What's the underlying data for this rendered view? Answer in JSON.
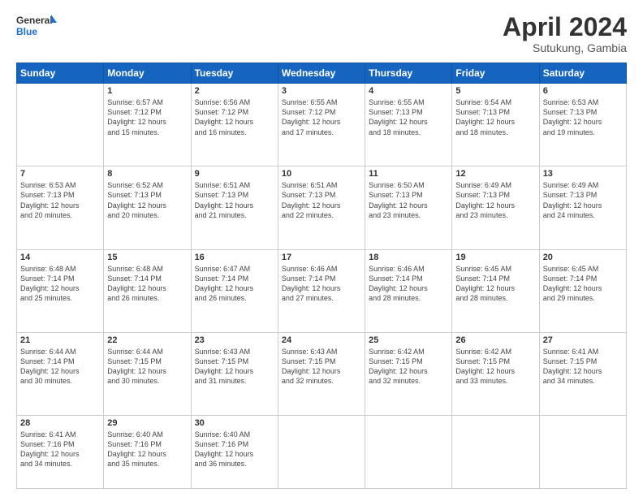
{
  "header": {
    "logo_line1": "General",
    "logo_line2": "Blue",
    "month": "April 2024",
    "location": "Sutukung, Gambia"
  },
  "days_of_week": [
    "Sunday",
    "Monday",
    "Tuesday",
    "Wednesday",
    "Thursday",
    "Friday",
    "Saturday"
  ],
  "weeks": [
    [
      {
        "day": "",
        "info": ""
      },
      {
        "day": "1",
        "info": "Sunrise: 6:57 AM\nSunset: 7:12 PM\nDaylight: 12 hours\nand 15 minutes."
      },
      {
        "day": "2",
        "info": "Sunrise: 6:56 AM\nSunset: 7:12 PM\nDaylight: 12 hours\nand 16 minutes."
      },
      {
        "day": "3",
        "info": "Sunrise: 6:55 AM\nSunset: 7:12 PM\nDaylight: 12 hours\nand 17 minutes."
      },
      {
        "day": "4",
        "info": "Sunrise: 6:55 AM\nSunset: 7:13 PM\nDaylight: 12 hours\nand 18 minutes."
      },
      {
        "day": "5",
        "info": "Sunrise: 6:54 AM\nSunset: 7:13 PM\nDaylight: 12 hours\nand 18 minutes."
      },
      {
        "day": "6",
        "info": "Sunrise: 6:53 AM\nSunset: 7:13 PM\nDaylight: 12 hours\nand 19 minutes."
      }
    ],
    [
      {
        "day": "7",
        "info": "Sunrise: 6:53 AM\nSunset: 7:13 PM\nDaylight: 12 hours\nand 20 minutes."
      },
      {
        "day": "8",
        "info": "Sunrise: 6:52 AM\nSunset: 7:13 PM\nDaylight: 12 hours\nand 20 minutes."
      },
      {
        "day": "9",
        "info": "Sunrise: 6:51 AM\nSunset: 7:13 PM\nDaylight: 12 hours\nand 21 minutes."
      },
      {
        "day": "10",
        "info": "Sunrise: 6:51 AM\nSunset: 7:13 PM\nDaylight: 12 hours\nand 22 minutes."
      },
      {
        "day": "11",
        "info": "Sunrise: 6:50 AM\nSunset: 7:13 PM\nDaylight: 12 hours\nand 23 minutes."
      },
      {
        "day": "12",
        "info": "Sunrise: 6:49 AM\nSunset: 7:13 PM\nDaylight: 12 hours\nand 23 minutes."
      },
      {
        "day": "13",
        "info": "Sunrise: 6:49 AM\nSunset: 7:13 PM\nDaylight: 12 hours\nand 24 minutes."
      }
    ],
    [
      {
        "day": "14",
        "info": "Sunrise: 6:48 AM\nSunset: 7:14 PM\nDaylight: 12 hours\nand 25 minutes."
      },
      {
        "day": "15",
        "info": "Sunrise: 6:48 AM\nSunset: 7:14 PM\nDaylight: 12 hours\nand 26 minutes."
      },
      {
        "day": "16",
        "info": "Sunrise: 6:47 AM\nSunset: 7:14 PM\nDaylight: 12 hours\nand 26 minutes."
      },
      {
        "day": "17",
        "info": "Sunrise: 6:46 AM\nSunset: 7:14 PM\nDaylight: 12 hours\nand 27 minutes."
      },
      {
        "day": "18",
        "info": "Sunrise: 6:46 AM\nSunset: 7:14 PM\nDaylight: 12 hours\nand 28 minutes."
      },
      {
        "day": "19",
        "info": "Sunrise: 6:45 AM\nSunset: 7:14 PM\nDaylight: 12 hours\nand 28 minutes."
      },
      {
        "day": "20",
        "info": "Sunrise: 6:45 AM\nSunset: 7:14 PM\nDaylight: 12 hours\nand 29 minutes."
      }
    ],
    [
      {
        "day": "21",
        "info": "Sunrise: 6:44 AM\nSunset: 7:14 PM\nDaylight: 12 hours\nand 30 minutes."
      },
      {
        "day": "22",
        "info": "Sunrise: 6:44 AM\nSunset: 7:15 PM\nDaylight: 12 hours\nand 30 minutes."
      },
      {
        "day": "23",
        "info": "Sunrise: 6:43 AM\nSunset: 7:15 PM\nDaylight: 12 hours\nand 31 minutes."
      },
      {
        "day": "24",
        "info": "Sunrise: 6:43 AM\nSunset: 7:15 PM\nDaylight: 12 hours\nand 32 minutes."
      },
      {
        "day": "25",
        "info": "Sunrise: 6:42 AM\nSunset: 7:15 PM\nDaylight: 12 hours\nand 32 minutes."
      },
      {
        "day": "26",
        "info": "Sunrise: 6:42 AM\nSunset: 7:15 PM\nDaylight: 12 hours\nand 33 minutes."
      },
      {
        "day": "27",
        "info": "Sunrise: 6:41 AM\nSunset: 7:15 PM\nDaylight: 12 hours\nand 34 minutes."
      }
    ],
    [
      {
        "day": "28",
        "info": "Sunrise: 6:41 AM\nSunset: 7:16 PM\nDaylight: 12 hours\nand 34 minutes."
      },
      {
        "day": "29",
        "info": "Sunrise: 6:40 AM\nSunset: 7:16 PM\nDaylight: 12 hours\nand 35 minutes."
      },
      {
        "day": "30",
        "info": "Sunrise: 6:40 AM\nSunset: 7:16 PM\nDaylight: 12 hours\nand 36 minutes."
      },
      {
        "day": "",
        "info": ""
      },
      {
        "day": "",
        "info": ""
      },
      {
        "day": "",
        "info": ""
      },
      {
        "day": "",
        "info": ""
      }
    ]
  ]
}
